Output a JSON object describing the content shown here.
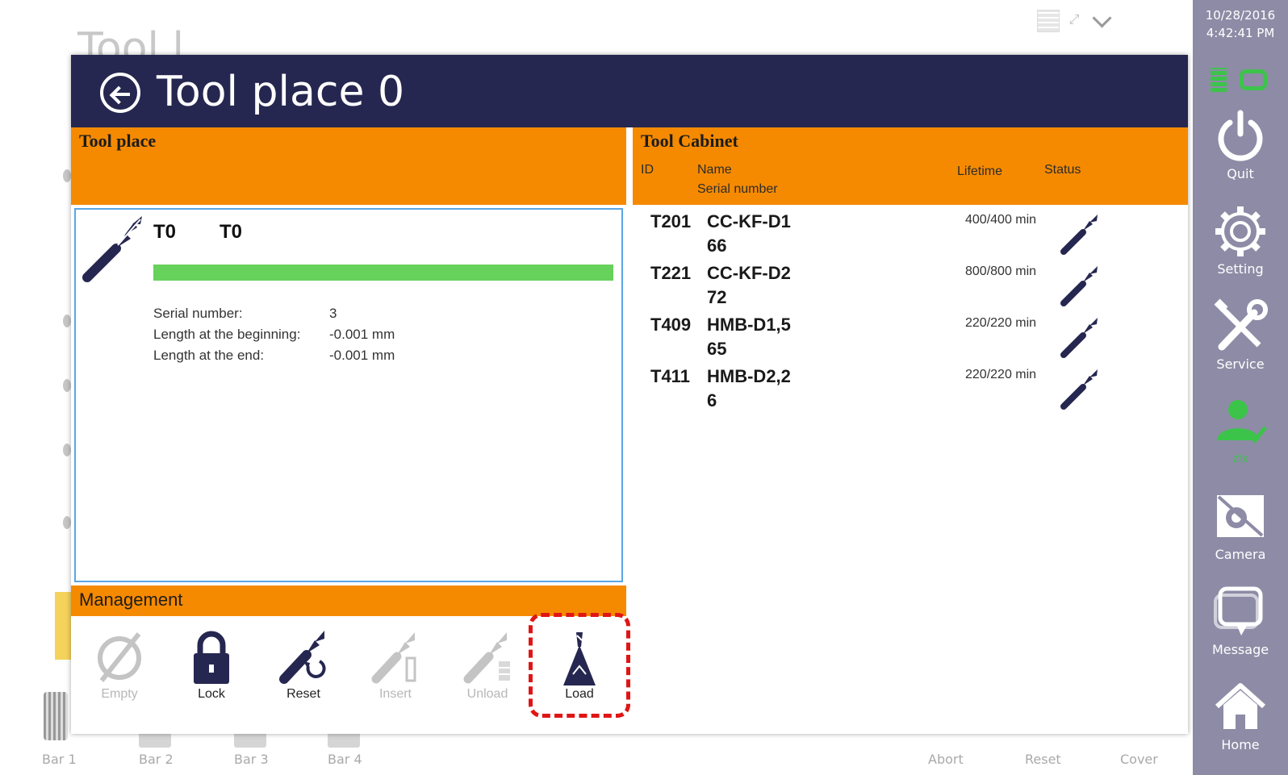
{
  "background": {
    "title": "Tool l...",
    "bottom_bar": [
      {
        "label": "Bar 1"
      },
      {
        "label": "Bar 2"
      },
      {
        "label": "Bar 3"
      },
      {
        "label": "Bar 4"
      },
      {
        "label": "Abort"
      },
      {
        "label": "Reset"
      },
      {
        "label": "Cover"
      }
    ]
  },
  "sidebar": {
    "date": "10/28/2016",
    "time": "4:42:41 PM",
    "items": [
      {
        "label": "Quit",
        "icon": "power-icon"
      },
      {
        "label": "Setting",
        "icon": "gear-icon"
      },
      {
        "label": "Service",
        "icon": "wrench-screwdriver-icon"
      },
      {
        "label": "zfx",
        "icon": "user-icon"
      },
      {
        "label": "Camera",
        "icon": "camera-icon"
      },
      {
        "label": "Message",
        "icon": "message-icon"
      },
      {
        "label": "Home",
        "icon": "home-icon"
      }
    ],
    "accent_color": "#3cc34a"
  },
  "dialog": {
    "title": "Tool place 0",
    "tool_place": {
      "header": "Tool place",
      "id_a": "T0",
      "id_b": "T0",
      "lifetime_fraction": 1.0,
      "details": [
        {
          "key": "Serial number:",
          "value": "3"
        },
        {
          "key": "Length at the beginning:",
          "value": "-0.001 mm"
        },
        {
          "key": "Length at the end:",
          "value": "-0.001 mm"
        }
      ]
    },
    "management": {
      "header": "Management",
      "buttons": [
        {
          "label": "Empty",
          "enabled": false,
          "icon": "empty-icon"
        },
        {
          "label": "Lock",
          "enabled": true,
          "icon": "lock-icon"
        },
        {
          "label": "Reset",
          "enabled": true,
          "icon": "reset-tool-icon"
        },
        {
          "label": "Insert",
          "enabled": false,
          "icon": "insert-tool-icon"
        },
        {
          "label": "Unload",
          "enabled": false,
          "icon": "unload-tool-icon"
        },
        {
          "label": "Load",
          "enabled": true,
          "icon": "load-tool-icon"
        }
      ]
    },
    "tool_cabinet": {
      "header": "Tool Cabinet",
      "columns": {
        "id": "ID",
        "name": "Name",
        "serial": "Serial number",
        "lifetime": "Lifetime",
        "status": "Status"
      },
      "rows": [
        {
          "id": "T201",
          "name": "CC-KF-D1",
          "serial": "66",
          "lifetime": "400/400 min"
        },
        {
          "id": "T221",
          "name": "CC-KF-D2",
          "serial": "72",
          "lifetime": "800/800 min"
        },
        {
          "id": "T409",
          "name": "HMB-D1,5",
          "serial": "65",
          "lifetime": "220/220 min"
        },
        {
          "id": "T411",
          "name": "HMB-D2,2",
          "serial": "6",
          "lifetime": "220/220 min"
        }
      ]
    },
    "colors": {
      "header_bg": "#262750",
      "section_orange": "#f58a00",
      "progress_green": "#66d15b",
      "highlight_red": "#e01515"
    }
  }
}
